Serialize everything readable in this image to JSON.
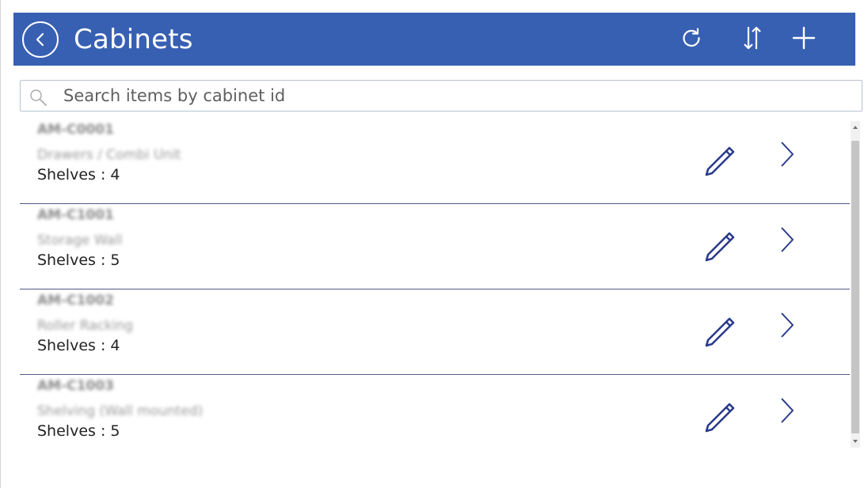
{
  "header": {
    "title": "Cabinets",
    "background": "#3760b3",
    "icons": [
      "back-icon",
      "refresh-icon",
      "sort-icon",
      "add-icon"
    ]
  },
  "search": {
    "placeholder": "Search items by cabinet id",
    "value": ""
  },
  "items": [
    {
      "id": "AM-C0001",
      "type": "Drawers / Combi Unit",
      "shelves": "Shelves : 4"
    },
    {
      "id": "AM-C1001",
      "type": "Storage Wall",
      "shelves": "Shelves : 5"
    },
    {
      "id": "AM-C1002",
      "type": "Roller Racking",
      "shelves": "Shelves : 4"
    },
    {
      "id": "AM-C1003",
      "type": "Shelving (Wall mounted)",
      "shelves": "Shelves : 5"
    }
  ],
  "colors": {
    "accent": "#3760b3",
    "icon_navy": "#2a3a8c",
    "divider": "#4d5a86"
  }
}
